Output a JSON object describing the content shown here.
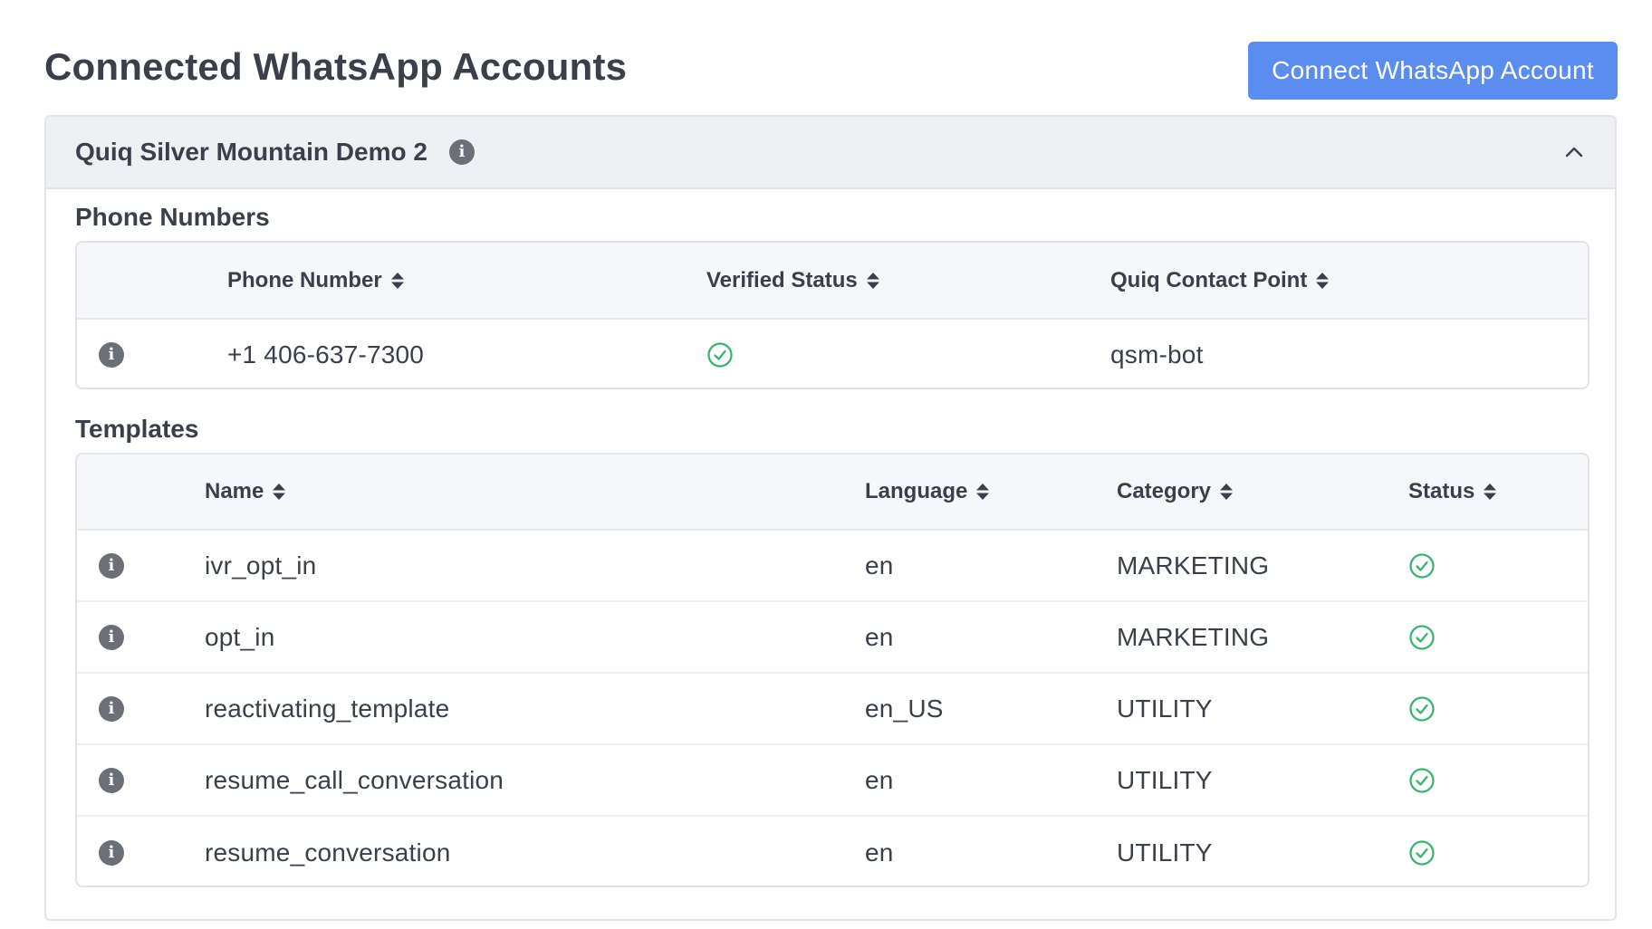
{
  "page": {
    "title": "Connected WhatsApp Accounts",
    "connect_button": "Connect WhatsApp Account"
  },
  "colors": {
    "accent": "#5b8def",
    "success": "#3cb371",
    "info_icon": "#6b6f78",
    "header_bg": "#eef0f3"
  },
  "account": {
    "name": "Quiq Silver Mountain Demo 2",
    "info_icon": "info-icon",
    "collapse_icon": "chevron-up-icon"
  },
  "phone_numbers": {
    "title": "Phone Numbers",
    "columns": [
      "Phone Number",
      "Verified Status",
      "Quiq Contact Point"
    ],
    "rows": [
      {
        "phone": "+1 406-637-7300",
        "verified": "check-circle-icon",
        "contact_point": "qsm-bot"
      }
    ]
  },
  "templates": {
    "title": "Templates",
    "columns": [
      "Name",
      "Language",
      "Category",
      "Status"
    ],
    "rows": [
      {
        "name": "ivr_opt_in",
        "language": "en",
        "category": "MARKETING",
        "status": "check-circle-icon"
      },
      {
        "name": "opt_in",
        "language": "en",
        "category": "MARKETING",
        "status": "check-circle-icon"
      },
      {
        "name": "reactivating_template",
        "language": "en_US",
        "category": "UTILITY",
        "status": "check-circle-icon"
      },
      {
        "name": "resume_call_conversation",
        "language": "en",
        "category": "UTILITY",
        "status": "check-circle-icon"
      },
      {
        "name": "resume_conversation",
        "language": "en",
        "category": "UTILITY",
        "status": "check-circle-icon"
      }
    ]
  }
}
